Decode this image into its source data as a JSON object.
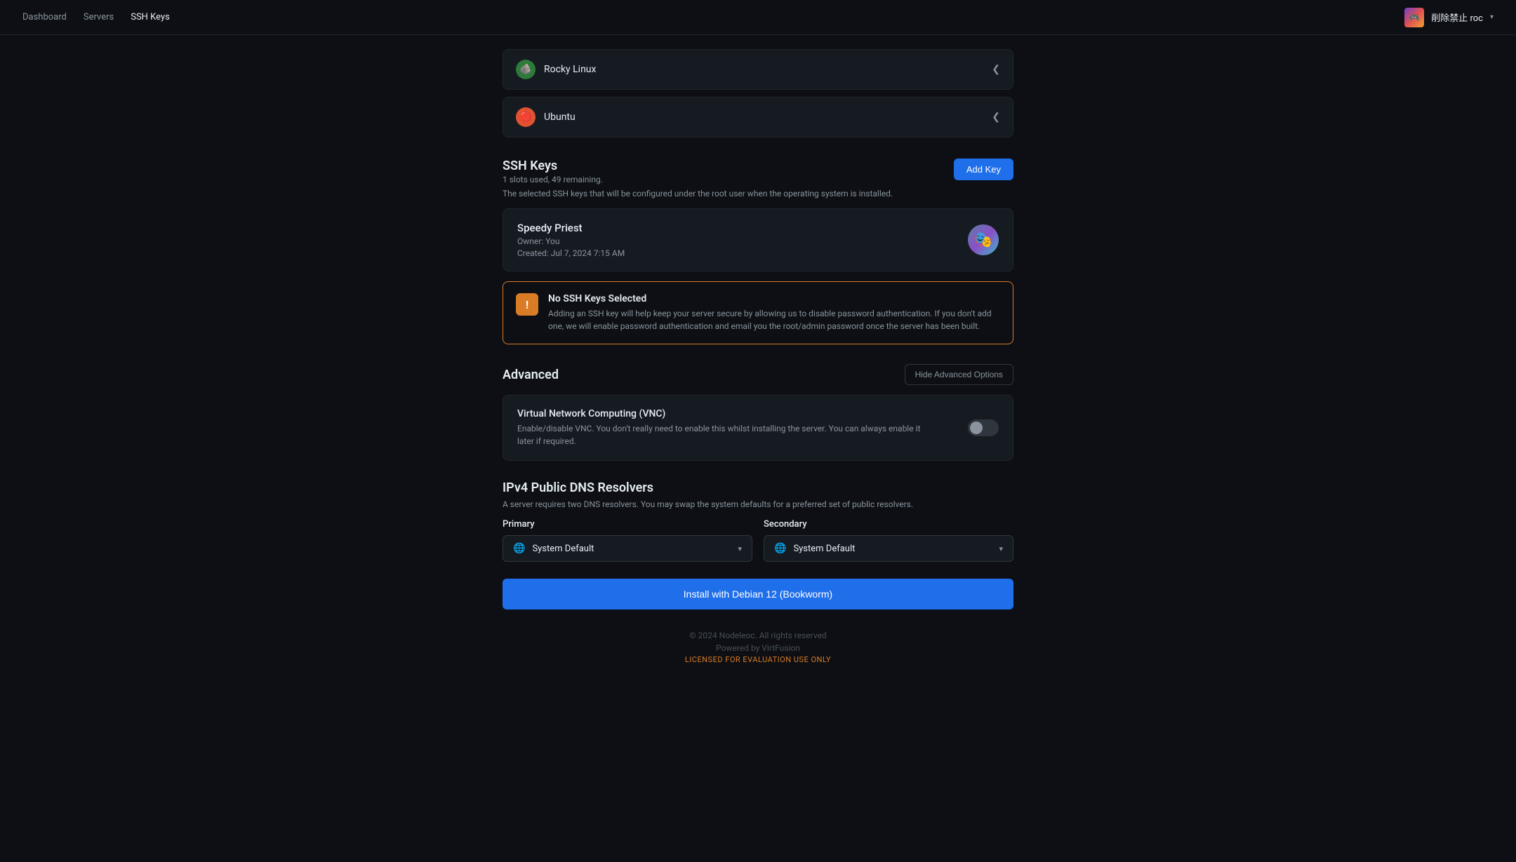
{
  "nav": {
    "links": [
      {
        "label": "Dashboard",
        "active": false
      },
      {
        "label": "Servers",
        "active": false
      },
      {
        "label": "SSH Keys",
        "active": true
      }
    ],
    "user": {
      "name": "削除禁止 roc",
      "caret": "▾"
    }
  },
  "os_items": [
    {
      "name": "Rocky Linux",
      "icon_label": "R",
      "icon_class": "os-rocky"
    },
    {
      "name": "Ubuntu",
      "icon_label": "U",
      "icon_class": "os-ubuntu"
    }
  ],
  "ssh_section": {
    "title": "SSH Keys",
    "slots_info": "1 slots used, 49 remaining.",
    "add_button_label": "Add Key",
    "description": "The selected SSH keys that will be configured under the root user when the operating system is installed.",
    "keys": [
      {
        "name": "Speedy Priest",
        "owner": "Owner: You",
        "created": "Created: Jul 7, 2024 7:15 AM"
      }
    ]
  },
  "warning": {
    "title": "No SSH Keys Selected",
    "icon": "!",
    "text": "Adding an SSH key will help keep your server secure by allowing us to disable password authentication. If you don't add one, we will enable password authentication and email you the root/admin password once the server has been built."
  },
  "advanced": {
    "title": "Advanced",
    "hide_button_label": "Hide Advanced Options",
    "vnc": {
      "title": "Virtual Network Computing (VNC)",
      "description": "Enable/disable VNC. You don't really need to enable this whilst installing the server. You can always enable it later if required."
    }
  },
  "dns": {
    "title": "IPv4 Public DNS Resolvers",
    "description": "A server requires two DNS resolvers. You may swap the system defaults for a preferred set of public resolvers.",
    "primary_label": "Primary",
    "secondary_label": "Secondary",
    "primary_value": "System Default",
    "secondary_value": "System Default"
  },
  "install": {
    "button_label": "Install with Debian 12 (Bookworm)"
  },
  "footer": {
    "copyright": "© 2024 Nodeleoc. All rights reserved",
    "powered_by": "Powered by VirtFusion",
    "eval_notice": "LICENSED FOR EVALUATION USE ONLY"
  }
}
